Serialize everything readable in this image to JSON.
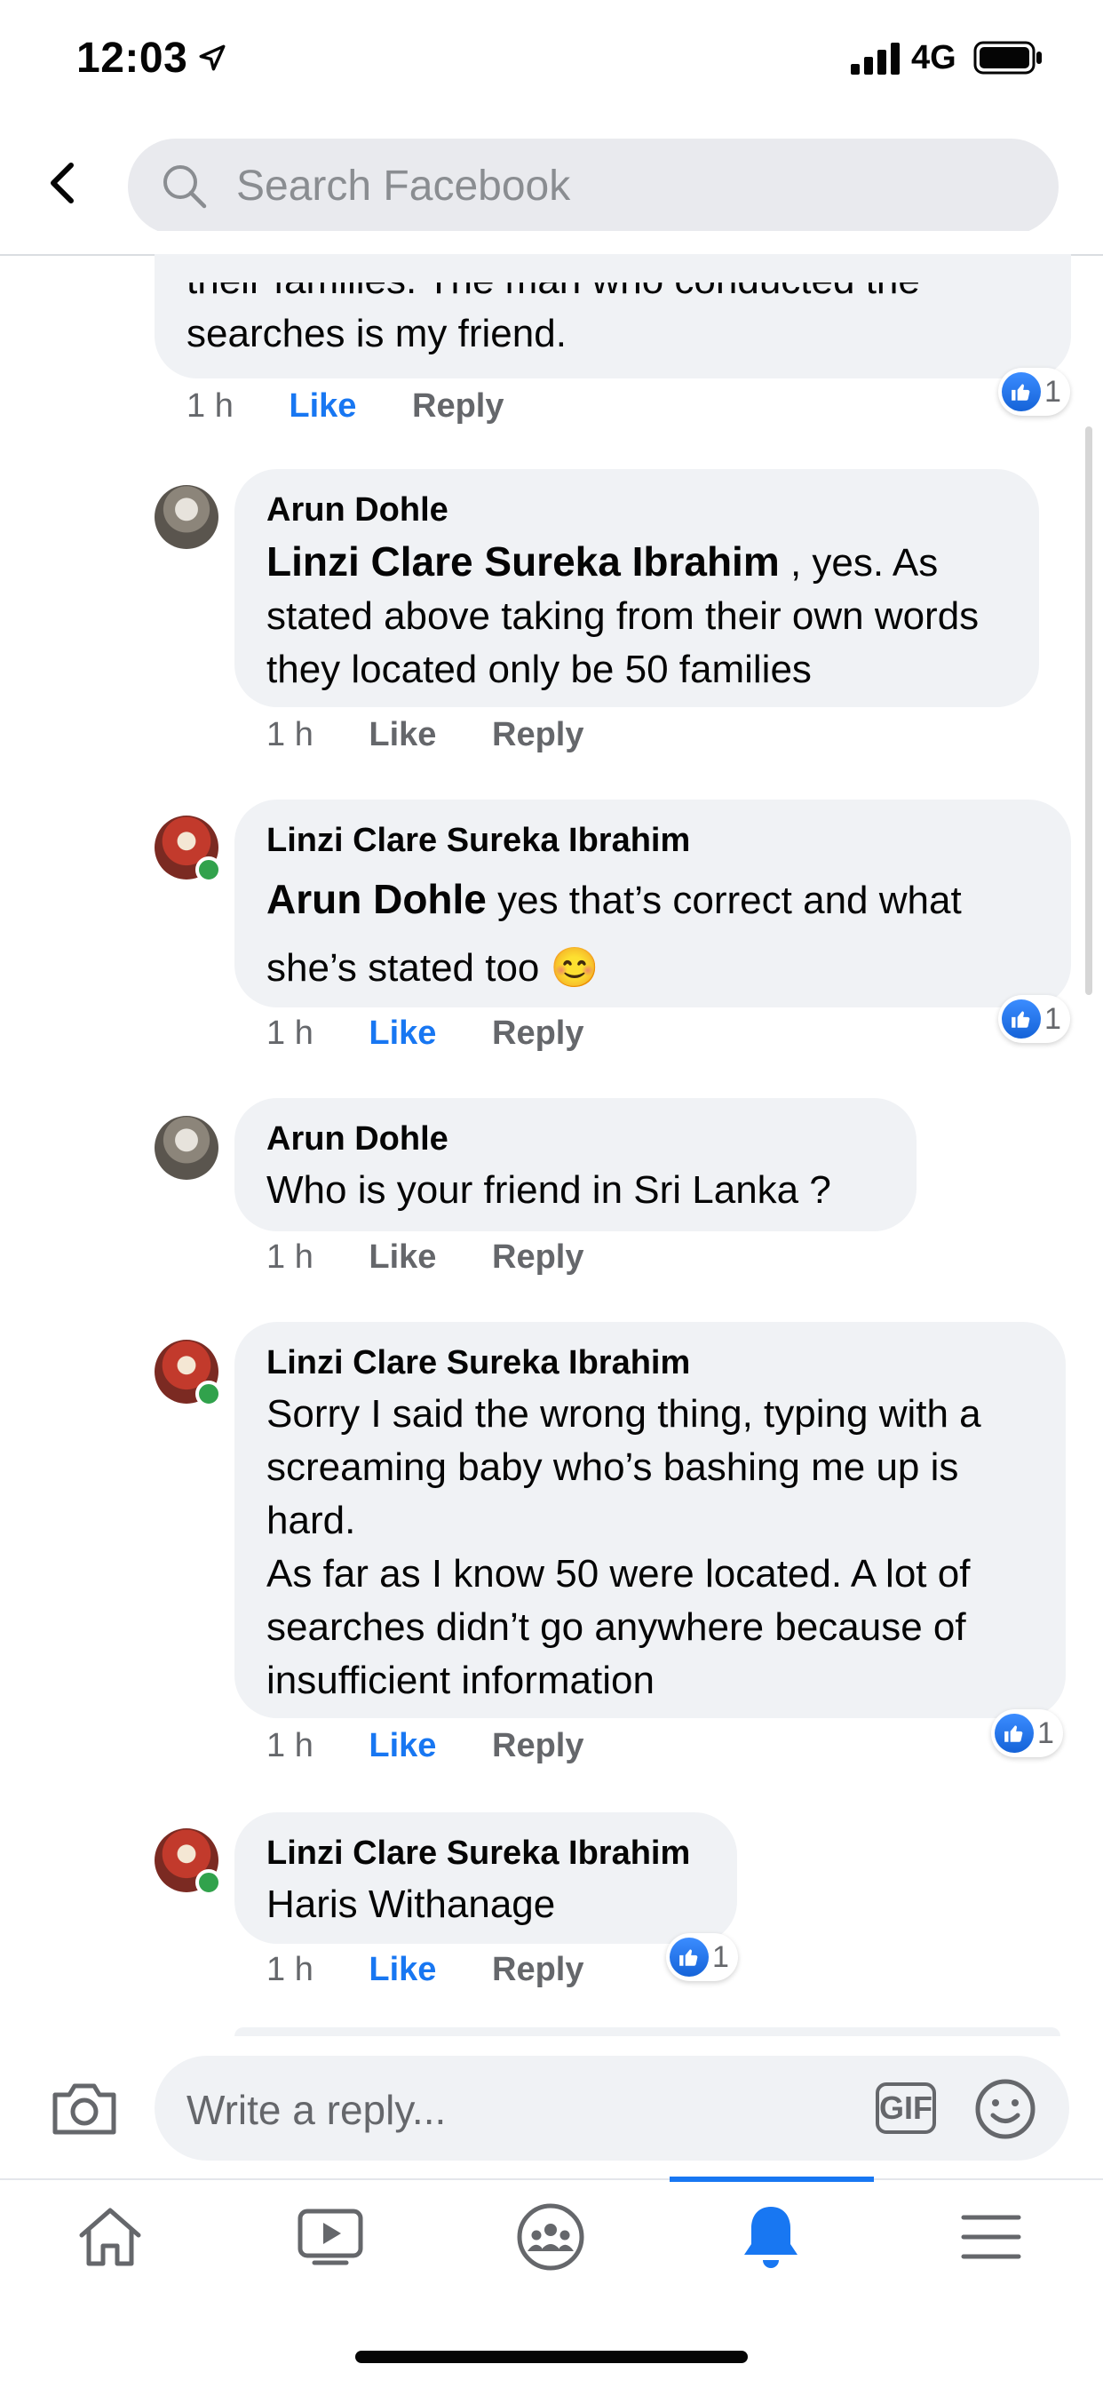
{
  "status_bar": {
    "time": "12:03",
    "network": "4G"
  },
  "header": {
    "search_placeholder": "Search Facebook"
  },
  "top_comment": {
    "text_line1": "their families. The man who conducted the",
    "text_line2": "searches is my friend.",
    "time": "1 h",
    "like": "Like",
    "reply": "Reply",
    "reactions": "1"
  },
  "comments": [
    {
      "author": "Arun Dohle",
      "mention": "Linzi Clare Sureka Ibrahim",
      "text": " , yes. As stated above taking from their own words they located only be 50 families",
      "time": "1 h",
      "like": "Like",
      "reply": "Reply",
      "liked": false
    },
    {
      "author": "Linzi Clare Sureka Ibrahim",
      "mention": "Arun Dohle",
      "text": "  yes that’s correct and what she’s stated too 😊",
      "time": "1 h",
      "like": "Like",
      "reply": "Reply",
      "liked": true,
      "reactions": "1"
    },
    {
      "author": "Arun Dohle",
      "text": "Who is your friend in Sri Lanka ?",
      "time": "1 h",
      "like": "Like",
      "reply": "Reply",
      "liked": false
    },
    {
      "author": "Linzi Clare Sureka Ibrahim",
      "text_p1": "Sorry I said the wrong thing, typing with a screaming baby who’s bashing me up is hard.",
      "text_p2": "As far as I know 50 were located. A lot of searches didn’t go anywhere because of insufficient information",
      "time": "1 h",
      "like": "Like",
      "reply": "Reply",
      "liked": true,
      "reactions": "1"
    },
    {
      "author": "Linzi Clare Sureka Ibrahim",
      "text": "Haris Withanage",
      "time": "1 h",
      "like": "Like",
      "reply": "Reply",
      "liked": true,
      "reactions": "1"
    }
  ],
  "composer": {
    "placeholder": "Write a reply...",
    "gif_label": "GIF"
  },
  "tab_bar": {
    "active": "notifications"
  },
  "colors": {
    "accent": "#1877f2",
    "bubble": "#f0f2f5",
    "muted": "#65676b"
  }
}
